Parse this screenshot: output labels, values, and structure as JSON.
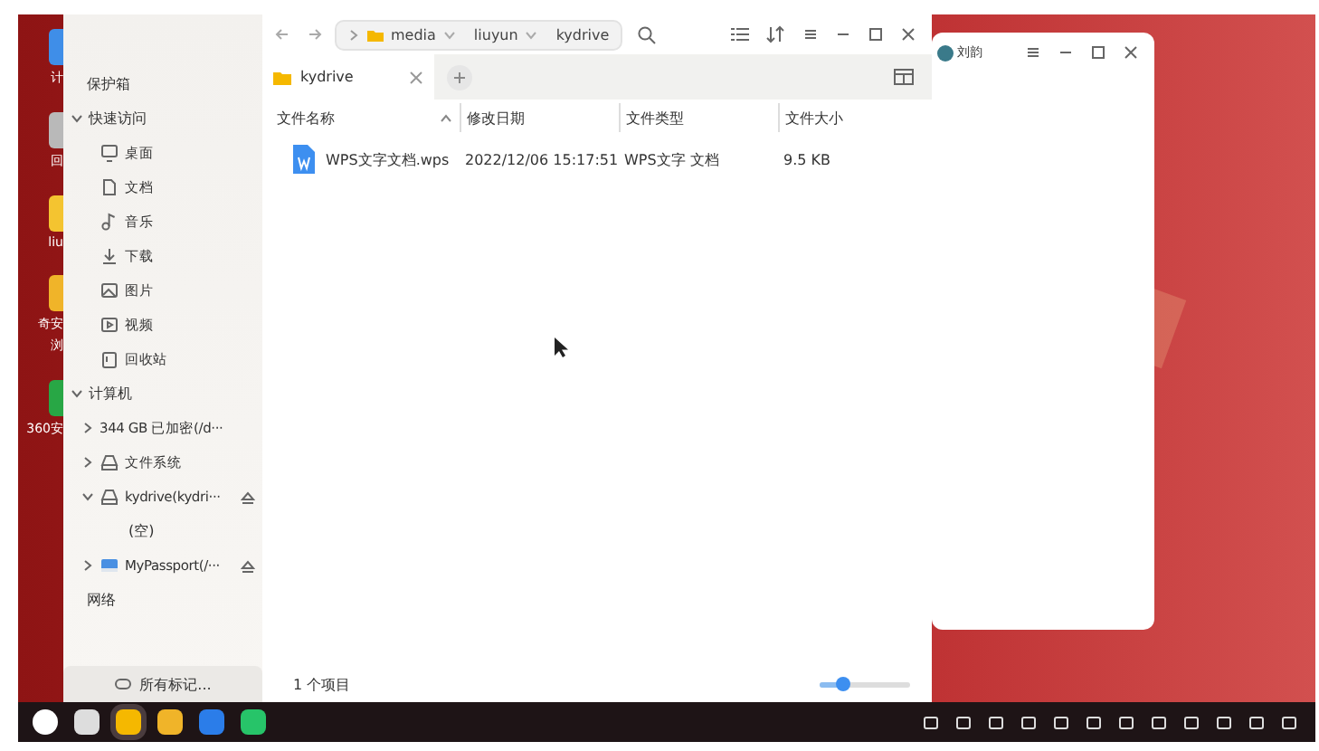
{
  "desktop": {
    "icons": [
      {
        "lines": [
          "计"
        ]
      },
      {
        "lines": [
          "回"
        ]
      },
      {
        "lines": [
          "liu"
        ]
      },
      {
        "lines": [
          "奇安",
          "浏"
        ]
      },
      {
        "lines": [
          "360安"
        ]
      }
    ]
  },
  "back_window": {
    "title": "刘韵"
  },
  "file_manager": {
    "breadcrumb": [
      "media",
      "liuyun",
      "kydrive"
    ],
    "sidebar": {
      "items": [
        {
          "label": "保护箱",
          "kind": "header"
        },
        {
          "label": "快速访问",
          "kind": "group",
          "expanded": true,
          "children": [
            {
              "label": "桌面",
              "kind": "place"
            },
            {
              "label": "文档",
              "kind": "place"
            },
            {
              "label": "音乐",
              "kind": "place"
            },
            {
              "label": "下载",
              "kind": "place"
            },
            {
              "label": "图片",
              "kind": "place"
            },
            {
              "label": "视频",
              "kind": "place"
            },
            {
              "label": "回收站",
              "kind": "place"
            }
          ]
        },
        {
          "label": "计算机",
          "kind": "group",
          "expanded": true,
          "children": [
            {
              "label": "344 GB 已加密(/d···",
              "kind": "device",
              "expanded": false,
              "eject": false
            },
            {
              "label": "文件系统",
              "kind": "device",
              "expanded": false,
              "eject": false
            },
            {
              "label": "kydrive(kydri···",
              "kind": "device",
              "expanded": true,
              "eject": true,
              "children": [
                {
                  "label": "(空)",
                  "kind": "empty"
                }
              ]
            },
            {
              "label": "MyPassport(/···",
              "kind": "device",
              "expanded": false,
              "eject": true
            }
          ]
        },
        {
          "label": "网络",
          "kind": "header"
        }
      ],
      "footer": "所有标记..."
    },
    "tabs": [
      {
        "label": "kydrive",
        "selected": true
      }
    ],
    "table": {
      "columns": [
        {
          "label": "文件名称",
          "sorted": true
        },
        {
          "label": "修改日期",
          "sorted": false
        },
        {
          "label": "文件类型",
          "sorted": false
        },
        {
          "label": "文件大小",
          "sorted": false
        }
      ],
      "rows": [
        {
          "name": "WPS文字文档.wps",
          "modified": "2022/12/06 15:17:51",
          "type": "WPS文字 文档",
          "size": "9.5 KB",
          "selected": false
        }
      ]
    },
    "status_bar": {
      "count": "1 个项目",
      "zoom": {
        "level": 0.25
      }
    }
  }
}
